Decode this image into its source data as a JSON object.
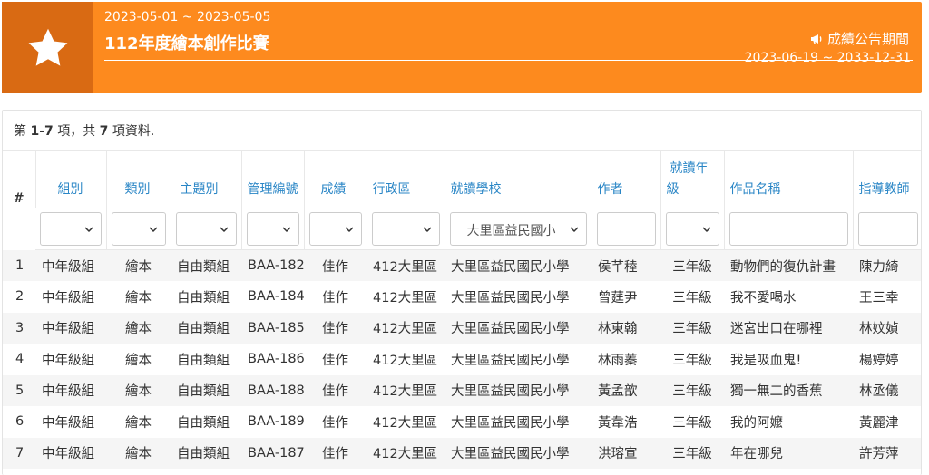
{
  "banner": {
    "date_range": "2023-05-01 ~ 2023-05-05",
    "title": "112年度繪本創作比賽",
    "announce_label": "成績公告期間",
    "announce_range": "2023-06-19 ~ 2033-12-31",
    "icon": "star-icon",
    "accent": "#fd8a1e",
    "icon_bg": "#d96a13"
  },
  "summary": {
    "prefix": "第",
    "range": "1-7",
    "middle": "項，共",
    "total": "7",
    "suffix": "項資料."
  },
  "columns": [
    {
      "label": "#"
    },
    {
      "label": "組別"
    },
    {
      "label": "類別"
    },
    {
      "label": "主題別"
    },
    {
      "label": "管理編號"
    },
    {
      "label": "成績"
    },
    {
      "label": "行政區"
    },
    {
      "label": "就讀學校"
    },
    {
      "label": "作者"
    },
    {
      "label": "就讀年級"
    },
    {
      "label": "作品名稱"
    },
    {
      "label": "指導教師"
    }
  ],
  "filters": {
    "school_selected": "大里區益民國小"
  },
  "rows": [
    {
      "n": "1",
      "group": "中年級組",
      "type": "繪本",
      "theme": "自由類組",
      "id": "BAA-182",
      "score": "佳作",
      "district": "412大里區",
      "school": "大里區益民國民小學",
      "author": "侯芊稑",
      "grade": "三年級",
      "work": "動物們的復仇計畫",
      "teacher": "陳力綺"
    },
    {
      "n": "2",
      "group": "中年級組",
      "type": "繪本",
      "theme": "自由類組",
      "id": "BAA-184",
      "score": "佳作",
      "district": "412大里區",
      "school": "大里區益民國民小學",
      "author": "曾莛尹",
      "grade": "三年級",
      "work": "我不愛喝水",
      "teacher": "王三幸"
    },
    {
      "n": "3",
      "group": "中年級組",
      "type": "繪本",
      "theme": "自由類組",
      "id": "BAA-185",
      "score": "佳作",
      "district": "412大里區",
      "school": "大里區益民國民小學",
      "author": "林東翰",
      "grade": "三年級",
      "work": "迷宮出口在哪裡",
      "teacher": "林妏媜"
    },
    {
      "n": "4",
      "group": "中年級組",
      "type": "繪本",
      "theme": "自由類組",
      "id": "BAA-186",
      "score": "佳作",
      "district": "412大里區",
      "school": "大里區益民國民小學",
      "author": "林雨蓁",
      "grade": "三年級",
      "work": "我是吸血鬼!",
      "teacher": "楊婷婷"
    },
    {
      "n": "5",
      "group": "中年級組",
      "type": "繪本",
      "theme": "自由類組",
      "id": "BAA-188",
      "score": "佳作",
      "district": "412大里區",
      "school": "大里區益民國民小學",
      "author": "黃孟歆",
      "grade": "三年級",
      "work": "獨一無二的香蕉",
      "teacher": "林丞儀"
    },
    {
      "n": "6",
      "group": "中年級組",
      "type": "繪本",
      "theme": "自由類組",
      "id": "BAA-189",
      "score": "佳作",
      "district": "412大里區",
      "school": "大里區益民國民小學",
      "author": "黃韋浩",
      "grade": "三年級",
      "work": "我的阿嬤",
      "teacher": "黃麗津"
    },
    {
      "n": "7",
      "group": "中年級組",
      "type": "繪本",
      "theme": "自由類組",
      "id": "BAA-187",
      "score": "佳作",
      "district": "412大里區",
      "school": "大里區益民國民小學",
      "author": "洪瑢宣",
      "grade": "三年級",
      "work": "年在哪兒",
      "teacher": "許芳萍"
    }
  ]
}
